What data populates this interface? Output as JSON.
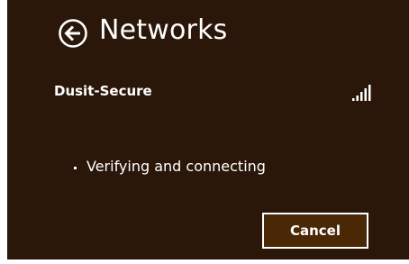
{
  "header": {
    "back_icon": "back-arrow-circle-icon",
    "title": "Networks"
  },
  "network": {
    "name": "Dusit-Secure",
    "signal_icon": "signal-strength-icon",
    "signal_bars": 5
  },
  "status": {
    "text": "Verifying and connecting"
  },
  "actions": {
    "cancel_label": "Cancel"
  },
  "colors": {
    "panel_background": "#2a1709",
    "button_background": "#4a2806",
    "foreground": "#ffffff"
  }
}
